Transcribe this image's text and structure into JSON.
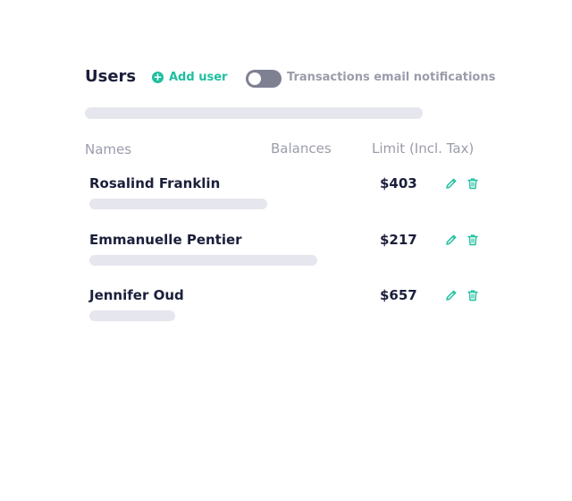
{
  "header": {
    "title": "Users",
    "add_user_label": "Add user",
    "add_user_icon": "plus-circle-icon",
    "notifications_toggle_label": "Transactions email notifications",
    "notifications_toggle_on": false
  },
  "table": {
    "columns": [
      "Names",
      "Balances",
      "Limit (Incl. Tax)"
    ],
    "rows": [
      {
        "name": "Rosalind Franklin",
        "limit": "$403"
      },
      {
        "name": "Emmanuelle Pentier",
        "limit": "$217"
      },
      {
        "name": "Jennifer Oud",
        "limit": "$657"
      }
    ],
    "row_actions": [
      "pencil-icon",
      "trash-icon"
    ]
  },
  "colors": {
    "accent": "#1fbf9f",
    "title_text": "#1b1f3b",
    "muted_text": "#9b9cab",
    "skeleton": "#e6e6ee",
    "toggle_off": "#7f8092"
  }
}
